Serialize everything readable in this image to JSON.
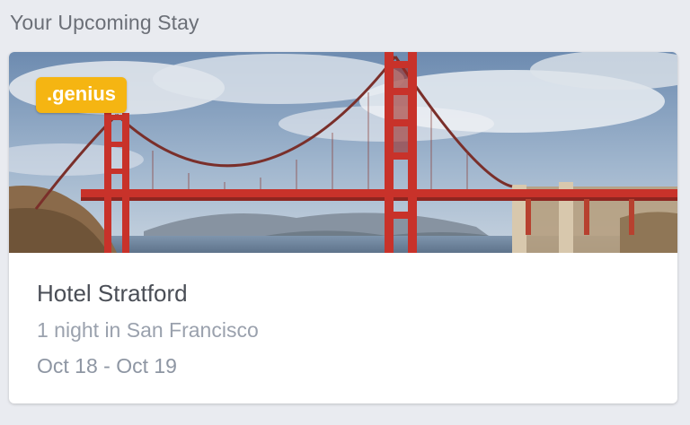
{
  "section": {
    "title": "Your Upcoming Stay"
  },
  "stay_card": {
    "badge": ".genius",
    "hotel_name": "Hotel Stratford",
    "stay_length": "1 night in San Francisco",
    "dates": "Oct 18 - Oct 19",
    "image_subject": "golden-gate-bridge"
  },
  "colors": {
    "page_background": "#e9ebf0",
    "card_background": "#ffffff",
    "badge_background": "#f5b512",
    "bridge_red": "#c8322a",
    "hotel_name_text": "#4a4e56",
    "secondary_text": "#9aa1ad"
  }
}
